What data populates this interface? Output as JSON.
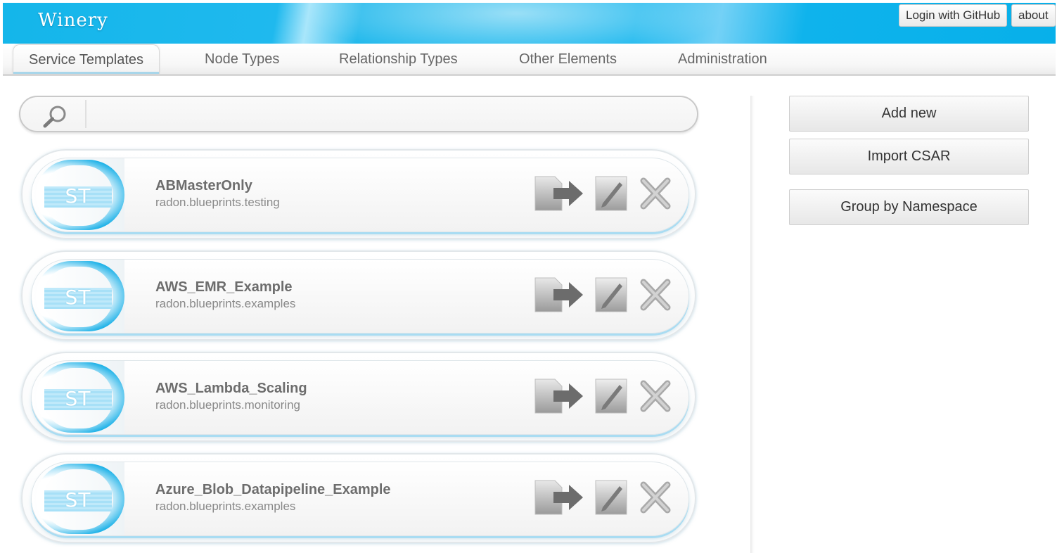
{
  "app": {
    "logo": "Winery"
  },
  "top_buttons": {
    "login": "Login with GitHub",
    "about": "about"
  },
  "tabs": [
    {
      "label": "Service Templates",
      "active": true
    },
    {
      "label": "Node Types",
      "active": false
    },
    {
      "label": "Relationship Types",
      "active": false
    },
    {
      "label": "Other Elements",
      "active": false
    },
    {
      "label": "Administration",
      "active": false
    }
  ],
  "search": {
    "icon": "search-icon",
    "value": "",
    "placeholder": ""
  },
  "badge_label": "ST",
  "items": [
    {
      "name": "ABMasterOnly",
      "namespace": "radon.blueprints.testing"
    },
    {
      "name": "AWS_EMR_Example",
      "namespace": "radon.blueprints.examples"
    },
    {
      "name": "AWS_Lambda_Scaling",
      "namespace": "radon.blueprints.monitoring"
    },
    {
      "name": "Azure_Blob_Datapipeline_Example",
      "namespace": "radon.blueprints.examples"
    }
  ],
  "item_actions": [
    "export-icon",
    "edit-pencil-icon",
    "delete-x-icon"
  ],
  "sidebar": {
    "add_new": "Add new",
    "import_csar": "Import CSAR",
    "group_by_namespace": "Group by Namespace"
  },
  "colors": {
    "header_blue": "#14b6ea",
    "accent_cyan": "#22b3e8"
  }
}
